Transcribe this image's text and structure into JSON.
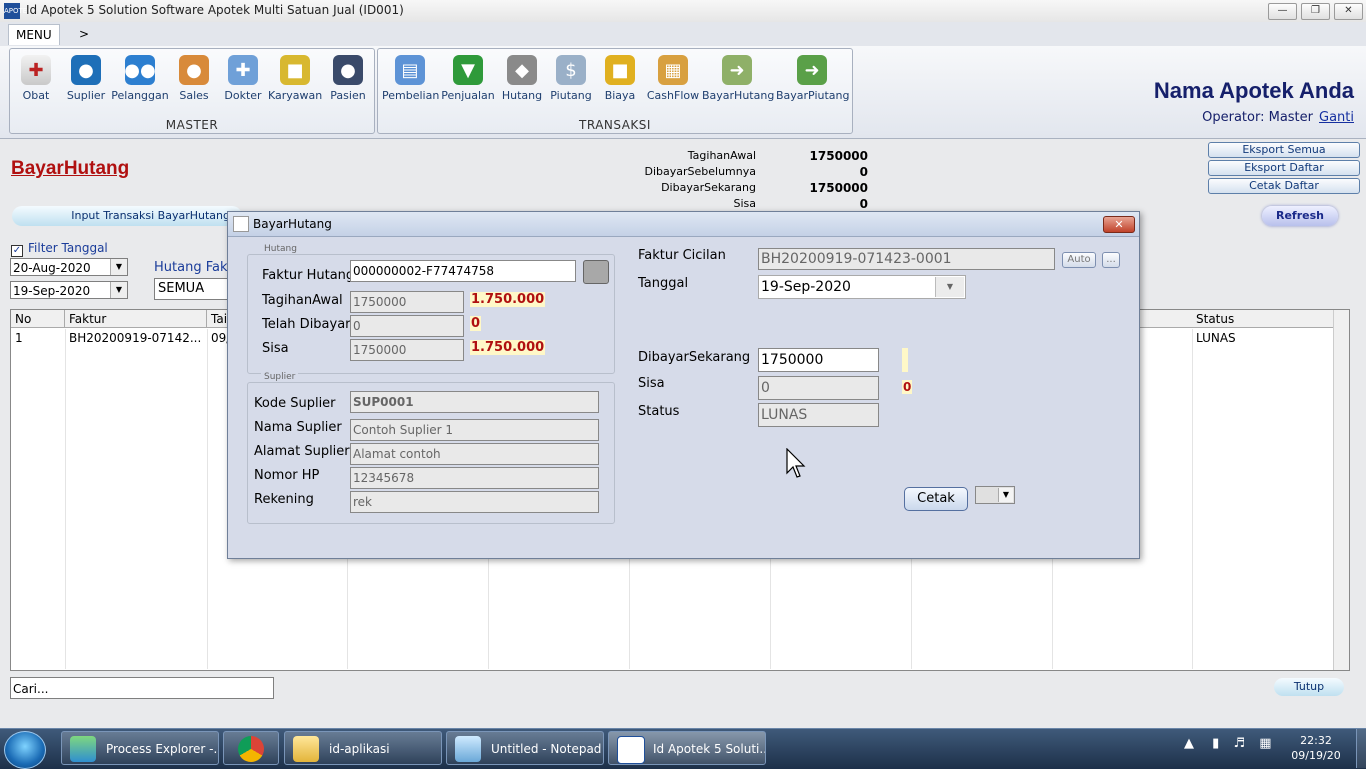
{
  "window": {
    "title": "Id Apotek 5 Solution Software Apotek Multi Satuan Jual (ID001)",
    "icon_label": "APOTEK"
  },
  "menu": {
    "tab_menu": "MENU",
    "tab_more": ">"
  },
  "ribbon": {
    "master": {
      "label": "MASTER",
      "items": [
        "Obat",
        "Suplier",
        "Pelanggan",
        "Sales",
        "Dokter",
        "Karyawan",
        "Pasien"
      ]
    },
    "transaksi": {
      "label": "TRANSAKSI",
      "items": [
        "Pembelian",
        "Penjualan",
        "Hutang",
        "Piutang",
        "Biaya",
        "CashFlow",
        "BayarHutang",
        "BayarPiutang"
      ]
    }
  },
  "header": {
    "apotek_name": "Nama Apotek Anda",
    "operator_label": "Operator: Master",
    "ganti_link": "Ganti"
  },
  "page": {
    "title": "BayarHutang",
    "summary": [
      {
        "label": "TagihanAwal",
        "value": "1750000"
      },
      {
        "label": "DibayarSebelumnya",
        "value": "0"
      },
      {
        "label": "DibayarSekarang",
        "value": "1750000"
      },
      {
        "label": "Sisa",
        "value": "0"
      }
    ],
    "buttons": {
      "eksport_semua": "Eksport Semua",
      "eksport_daftar": "Eksport Daftar",
      "cetak_daftar": "Cetak Daftar",
      "refresh": "Refresh",
      "input_transaksi": "Input Transaksi BayarHutang",
      "tutup": "Tutup"
    },
    "filter": {
      "label": "Filter Tanggal",
      "checked": true,
      "from": "20-Aug-2020",
      "to": "19-Sep-2020",
      "hutang_faktur_label": "Hutang Fakt",
      "hutang_faktur_value": "SEMUA"
    },
    "grid": {
      "columns": [
        "No",
        "Faktur",
        "Tai",
        "Status"
      ],
      "rows": [
        {
          "no": "1",
          "faktur": "BH20200919-07142...",
          "tgl": "09/",
          "status": "LUNAS"
        }
      ]
    },
    "search": {
      "value": "Cari..."
    }
  },
  "dialog": {
    "title": "BayarHutang",
    "hutang_group": "Hutang",
    "faktur_hutang_label": "Faktur Hutang",
    "faktur_hutang_value": "000000002-F77474758",
    "tagihan_awal_label": "TagihanAwal",
    "tagihan_awal_value": "1750000",
    "tagihan_awal_fmt": "1.750.000",
    "telah_dibayar_label": "Telah Dibayar",
    "telah_dibayar_value": "0",
    "telah_dibayar_fmt": "0",
    "sisa_label": "Sisa",
    "sisa_value": "1750000",
    "sisa_fmt": "1.750.000",
    "suplier_group": "Suplier",
    "kode_suplier_label": "Kode Suplier",
    "kode_suplier_value": "SUP0001",
    "nama_suplier_label": "Nama Suplier",
    "nama_suplier_value": "Contoh Suplier 1",
    "alamat_suplier_label": "Alamat Suplier",
    "alamat_suplier_value": "Alamat contoh",
    "nomor_hp_label": "Nomor HP",
    "nomor_hp_value": "12345678",
    "rekening_label": "Rekening",
    "rekening_value": "rek",
    "faktur_cicilan_label": "Faktur Cicilan",
    "faktur_cicilan_value": "BH20200919-071423-0001",
    "auto_label": "Auto",
    "dots_label": "...",
    "tanggal_label": "Tanggal",
    "tanggal_value": "19-Sep-2020",
    "dibayar_sekarang_label": "DibayarSekarang",
    "dibayar_sekarang_value": "1750000",
    "sisa2_label": "Sisa",
    "sisa2_value": "0",
    "sisa2_fmt": "0",
    "status_label": "Status",
    "status_value": "LUNAS",
    "cetak_label": "Cetak"
  },
  "taskbar": {
    "items": [
      "Process Explorer -...",
      "",
      "id-aplikasi",
      "Untitled - Notepad",
      "Id Apotek 5 Soluti..."
    ],
    "time": "22:32",
    "date": "09/19/20"
  }
}
